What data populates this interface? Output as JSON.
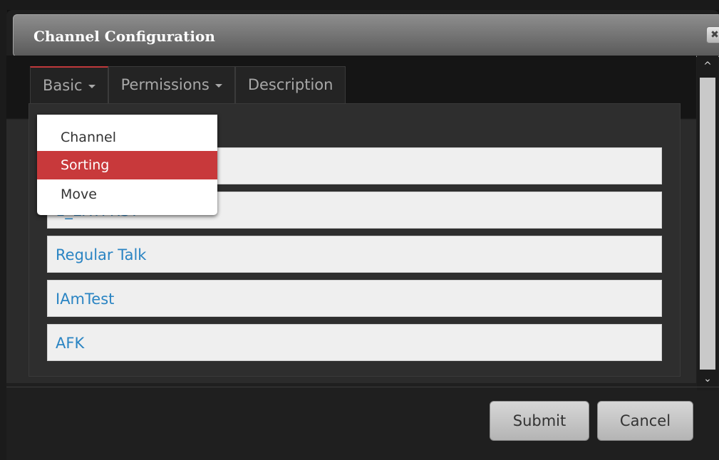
{
  "dialog": {
    "title": "Channel Configuration",
    "close_symbol": "✖"
  },
  "tabs": [
    {
      "label": "Basic",
      "has_dropdown": true,
      "active": true
    },
    {
      "label": "Permissions",
      "has_dropdown": true,
      "active": false
    },
    {
      "label": "Description",
      "has_dropdown": false,
      "active": false
    }
  ],
  "basic_menu": {
    "items": [
      {
        "label": "Channel",
        "selected": false
      },
      {
        "label": "Sorting",
        "selected": true
      },
      {
        "label": "Move",
        "selected": false
      }
    ]
  },
  "channels": [
    {
      "label": ""
    },
    {
      "label": "1_EXTFRST"
    },
    {
      "label": "Regular Talk"
    },
    {
      "label": "IAmTest"
    },
    {
      "label": "AFK"
    }
  ],
  "footer": {
    "submit_label": "Submit",
    "cancel_label": "Cancel"
  },
  "colors": {
    "accent": "#c8393b",
    "link": "#2a84c3"
  }
}
